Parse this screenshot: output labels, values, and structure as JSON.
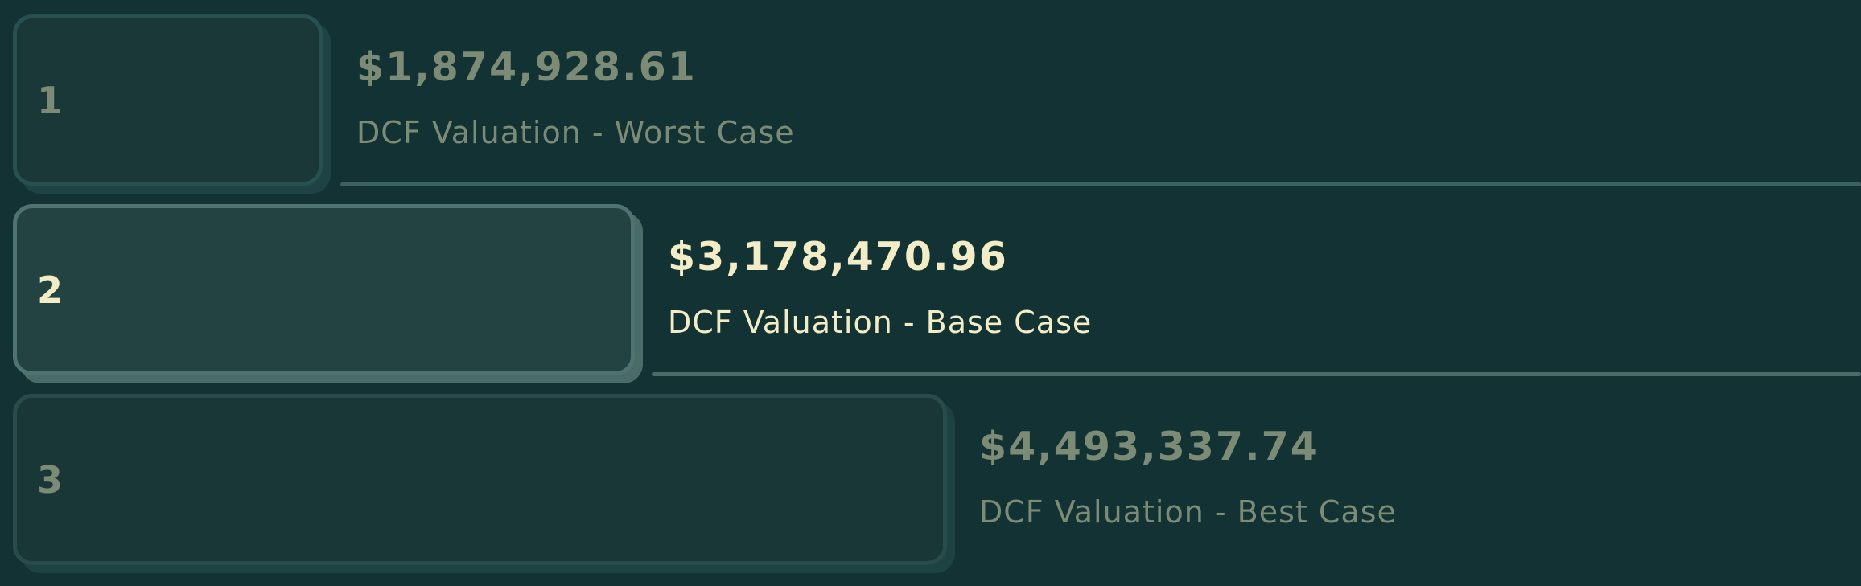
{
  "scenarios": [
    {
      "rank": "1",
      "amount": "$1,874,928.61",
      "label": "DCF Valuation - Worst Case",
      "active": false
    },
    {
      "rank": "2",
      "amount": "$3,178,470.96",
      "label": "DCF Valuation - Base Case",
      "active": true
    },
    {
      "rank": "3",
      "amount": "$4,493,337.74",
      "label": "DCF Valuation - Best Case",
      "active": false
    }
  ],
  "colors": {
    "background": "#133233",
    "text_active": "#f2edc6",
    "text_muted": "#7c8b76",
    "box_border_active": "#4f7370"
  }
}
